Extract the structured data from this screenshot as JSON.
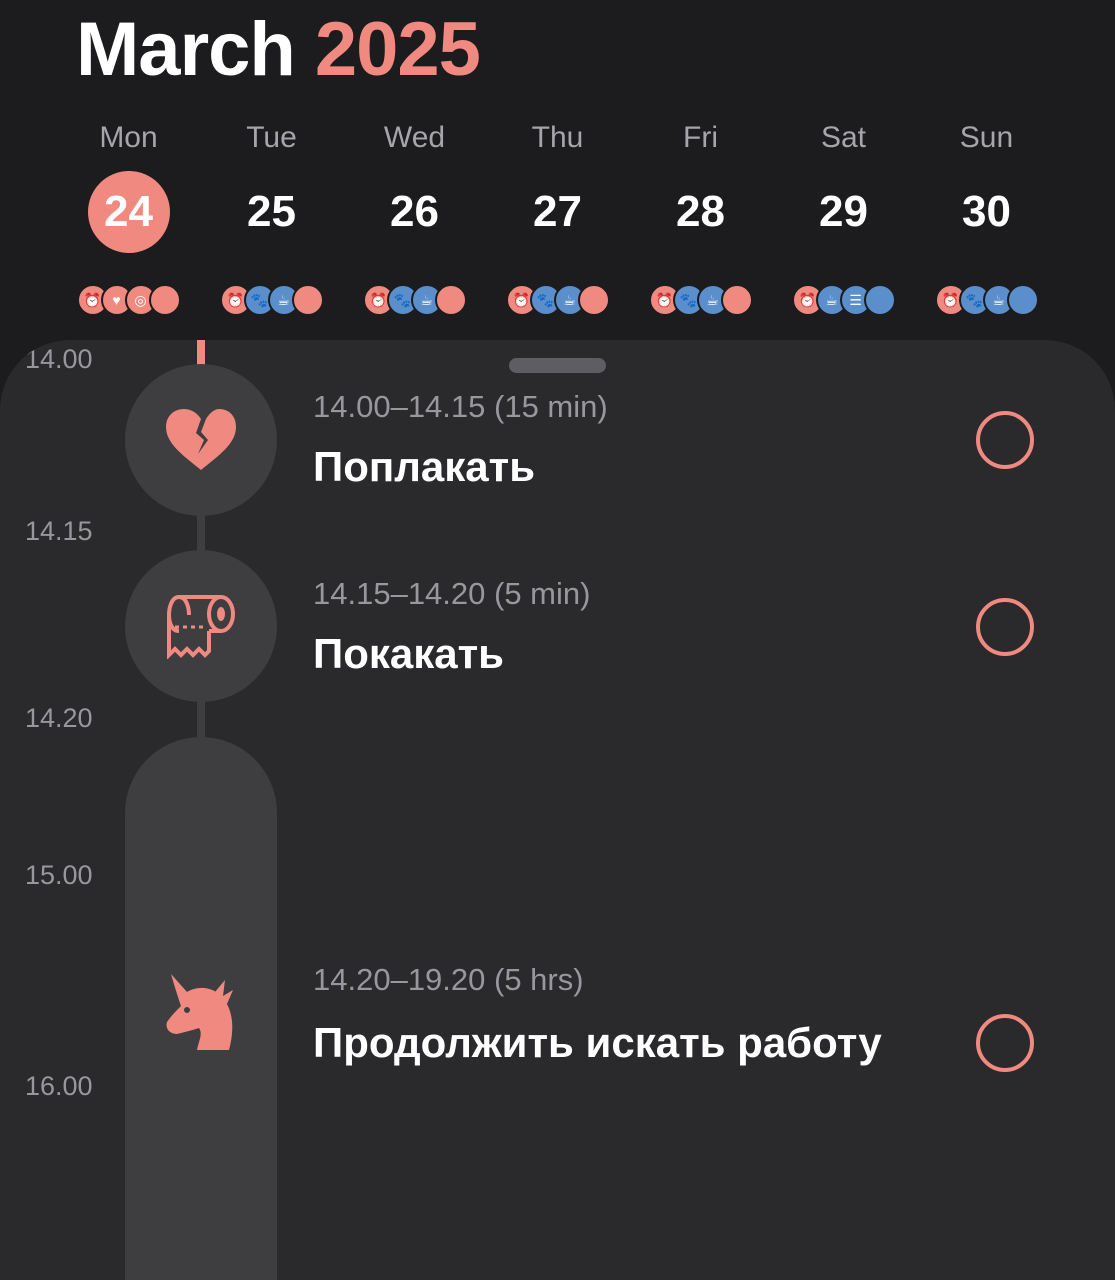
{
  "header": {
    "month": "March",
    "year": "2025"
  },
  "week": [
    {
      "dow": "Mon",
      "day": "24",
      "selected": true,
      "dots": [
        "pink",
        "pink",
        "pink",
        "pink"
      ]
    },
    {
      "dow": "Tue",
      "day": "25",
      "selected": false,
      "dots": [
        "pink",
        "blue",
        "blue",
        "pink"
      ]
    },
    {
      "dow": "Wed",
      "day": "26",
      "selected": false,
      "dots": [
        "pink",
        "blue",
        "blue",
        "pink"
      ]
    },
    {
      "dow": "Thu",
      "day": "27",
      "selected": false,
      "dots": [
        "pink",
        "blue",
        "blue",
        "pink"
      ]
    },
    {
      "dow": "Fri",
      "day": "28",
      "selected": false,
      "dots": [
        "pink",
        "blue",
        "blue",
        "pink"
      ]
    },
    {
      "dow": "Sat",
      "day": "29",
      "selected": false,
      "dots": [
        "pink",
        "blue",
        "blue",
        "blue"
      ]
    },
    {
      "dow": "Sun",
      "day": "30",
      "selected": false,
      "dots": [
        "pink",
        "blue",
        "blue",
        "blue"
      ]
    }
  ],
  "timeline": {
    "labels": [
      "14.00",
      "14.15",
      "14.20",
      "15.00",
      "16.00"
    ]
  },
  "tasks": [
    {
      "time": "14.00–14.15 (15 min)",
      "title": "Поплакать",
      "icon": "broken-heart-icon"
    },
    {
      "time": "14.15–14.20 (5 min)",
      "title": "Покакать",
      "icon": "toilet-paper-icon"
    },
    {
      "time": "14.20–19.20 (5 hrs)",
      "title": "Продолжить искать работу",
      "icon": "unicorn-icon"
    }
  ],
  "colors": {
    "accent": "#f08a80",
    "blue": "#5b8fcb",
    "background": "#1c1c1e",
    "sheet": "#2a2a2c"
  }
}
